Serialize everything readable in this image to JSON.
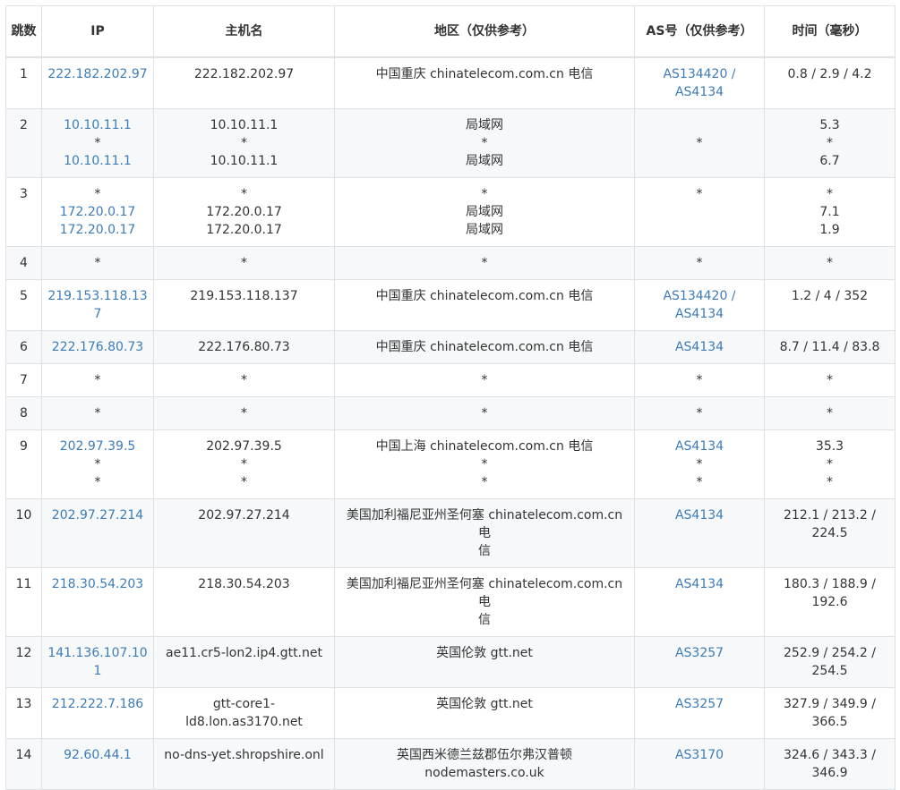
{
  "colors": {
    "link": "#3c7cb8",
    "border": "#dfe2e5",
    "stripe": "#f6f8fa",
    "text": "#333333"
  },
  "headers": {
    "hop": "跳数",
    "ip": "IP",
    "host": "主机名",
    "region": "地区（仅供参考）",
    "as": "AS号（仅供参考）",
    "time": "时间（毫秒）"
  },
  "rows": [
    {
      "hop": "1",
      "ip": [
        "222.182.202.97"
      ],
      "host": [
        "222.182.202.97"
      ],
      "region": [
        "中国重庆 chinatelecom.com.cn 电信"
      ],
      "as": [
        "AS134420 /",
        "AS4134"
      ],
      "time": [
        "0.8 / 2.9 / 4.2"
      ]
    },
    {
      "hop": "2",
      "ip": [
        "10.10.11.1",
        "*",
        "10.10.11.1"
      ],
      "host": [
        "10.10.11.1",
        "*",
        "10.10.11.1"
      ],
      "region": [
        "局域网",
        "*",
        "局域网"
      ],
      "as": [
        "",
        "*",
        ""
      ],
      "time": [
        "5.3",
        "*",
        "6.7"
      ]
    },
    {
      "hop": "3",
      "ip": [
        "*",
        "172.20.0.17",
        "172.20.0.17"
      ],
      "host": [
        "*",
        "172.20.0.17",
        "172.20.0.17"
      ],
      "region": [
        "*",
        "局域网",
        "局域网"
      ],
      "as": [
        "*"
      ],
      "time": [
        "*",
        "7.1",
        "1.9"
      ]
    },
    {
      "hop": "4",
      "ip": [
        "*"
      ],
      "host": [
        "*"
      ],
      "region": [
        "*"
      ],
      "as": [
        "*"
      ],
      "time": [
        "*"
      ]
    },
    {
      "hop": "5",
      "ip": [
        "219.153.118.137"
      ],
      "host": [
        "219.153.118.137"
      ],
      "region": [
        "中国重庆 chinatelecom.com.cn 电信"
      ],
      "as": [
        "AS134420 /",
        "AS4134"
      ],
      "time": [
        "1.2 / 4 / 352"
      ]
    },
    {
      "hop": "6",
      "ip": [
        "222.176.80.73"
      ],
      "host": [
        "222.176.80.73"
      ],
      "region": [
        "中国重庆 chinatelecom.com.cn 电信"
      ],
      "as": [
        "AS4134"
      ],
      "time": [
        "8.7 / 11.4 / 83.8"
      ]
    },
    {
      "hop": "7",
      "ip": [
        "*"
      ],
      "host": [
        "*"
      ],
      "region": [
        "*"
      ],
      "as": [
        "*"
      ],
      "time": [
        "*"
      ]
    },
    {
      "hop": "8",
      "ip": [
        "*"
      ],
      "host": [
        "*"
      ],
      "region": [
        "*"
      ],
      "as": [
        "*"
      ],
      "time": [
        "*"
      ]
    },
    {
      "hop": "9",
      "ip": [
        "202.97.39.5",
        "*",
        "*"
      ],
      "host": [
        "202.97.39.5",
        "*",
        "*"
      ],
      "region": [
        "中国上海 chinatelecom.com.cn 电信",
        "*",
        "*"
      ],
      "as": [
        "AS4134",
        "*",
        "*"
      ],
      "time": [
        "35.3",
        "*",
        "*"
      ]
    },
    {
      "hop": "10",
      "ip": [
        "202.97.27.214"
      ],
      "host": [
        "202.97.27.214"
      ],
      "region": [
        "美国加利福尼亚州圣何塞 chinatelecom.com.cn 电",
        "信"
      ],
      "as": [
        "AS4134"
      ],
      "time": [
        "212.1 / 213.2 /",
        "224.5"
      ]
    },
    {
      "hop": "11",
      "ip": [
        "218.30.54.203"
      ],
      "host": [
        "218.30.54.203"
      ],
      "region": [
        "美国加利福尼亚州圣何塞 chinatelecom.com.cn 电",
        "信"
      ],
      "as": [
        "AS4134"
      ],
      "time": [
        "180.3 / 188.9 /",
        "192.6"
      ]
    },
    {
      "hop": "12",
      "ip": [
        "141.136.107.101"
      ],
      "host": [
        "ae11.cr5-lon2.ip4.gtt.net"
      ],
      "region": [
        "英国伦敦 gtt.net"
      ],
      "as": [
        "AS3257"
      ],
      "time": [
        "252.9 / 254.2 /",
        "254.5"
      ]
    },
    {
      "hop": "13",
      "ip": [
        "212.222.7.186"
      ],
      "host": [
        "gtt-core1-",
        "ld8.lon.as3170.net"
      ],
      "region": [
        "英国伦敦 gtt.net"
      ],
      "as": [
        "AS3257"
      ],
      "time": [
        "327.9 / 349.9 /",
        "366.5"
      ]
    },
    {
      "hop": "14",
      "ip": [
        "92.60.44.1"
      ],
      "host": [
        "no-dns-yet.shropshire.onl"
      ],
      "region": [
        "英国西米德兰兹郡伍尔弗汉普顿",
        "nodemasters.co.uk"
      ],
      "as": [
        "AS3170"
      ],
      "time": [
        "324.6 / 343.3 /",
        "346.9"
      ]
    }
  ]
}
